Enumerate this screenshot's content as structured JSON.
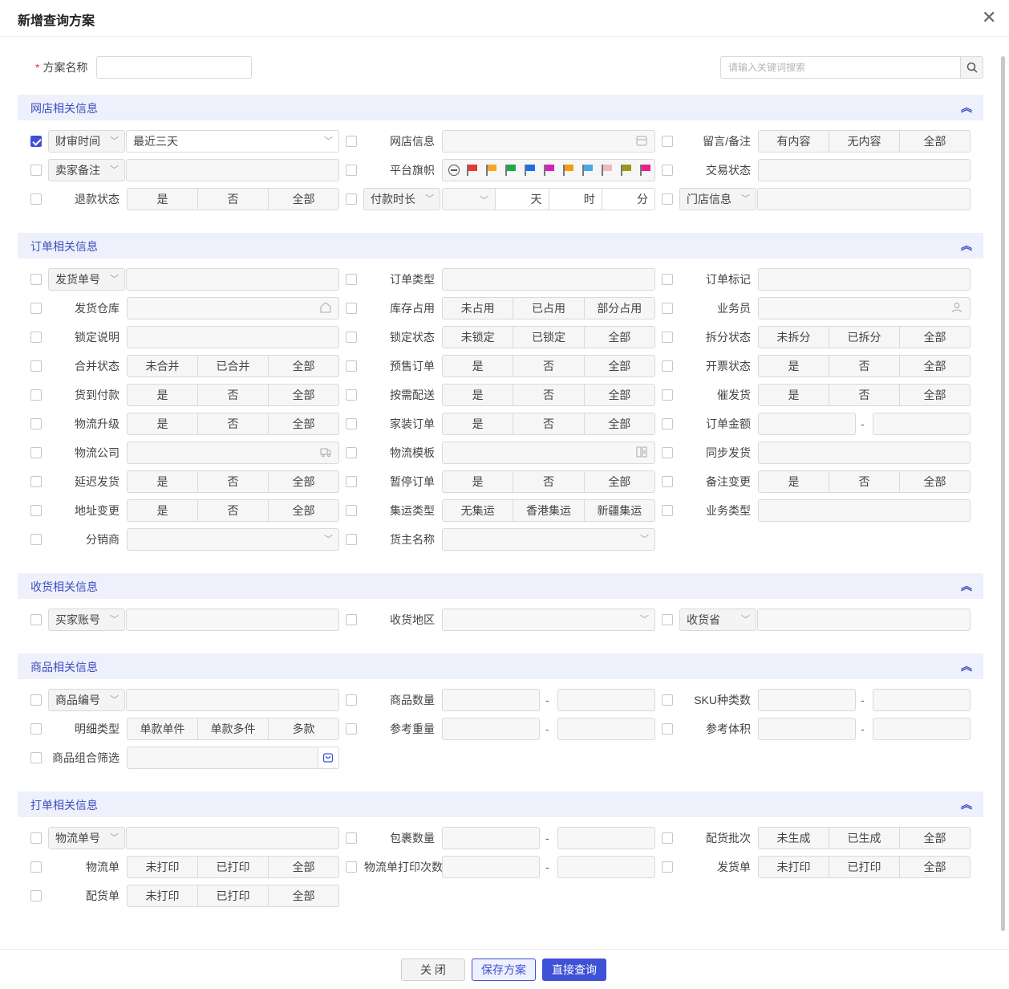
{
  "dialog": {
    "title": "新增查询方案"
  },
  "top": {
    "scheme_label": "方案名称",
    "required_mark": "*",
    "search_placeholder": "请输入关键词搜索"
  },
  "sections": {
    "shop": "网店相关信息",
    "order": "订单相关信息",
    "receive": "收货相关信息",
    "goods": "商品相关信息",
    "print": "打单相关信息"
  },
  "shop": {
    "audit_time": "财审时间",
    "audit_range": "最近三天",
    "shop_info": "网店信息",
    "message": "留言/备注",
    "message_opts": [
      "有内容",
      "无内容",
      "全部"
    ],
    "seller_memo": "卖家备注",
    "flag_label": "平台旗帜",
    "trade_status": "交易状态",
    "refund_status": "退款状态",
    "refund_opts": [
      "是",
      "否",
      "全部"
    ],
    "pay_duration": "付款时长",
    "pay_units": [
      "天",
      "时",
      "分"
    ],
    "store_info": "门店信息"
  },
  "order": {
    "ship_no": "发货单号",
    "order_type": "订单类型",
    "order_mark": "订单标记",
    "warehouse": "发货仓库",
    "stock": "库存占用",
    "stock_opts": [
      "未占用",
      "已占用",
      "部分占用"
    ],
    "salesman": "业务员",
    "lock_desc": "锁定说明",
    "lock_status": "锁定状态",
    "lock_opts": [
      "未锁定",
      "已锁定",
      "全部"
    ],
    "split_status": "拆分状态",
    "split_opts": [
      "未拆分",
      "已拆分",
      "全部"
    ],
    "merge_status": "合并状态",
    "merge_opts": [
      "未合并",
      "已合并",
      "全部"
    ],
    "presale": "预售订单",
    "invoice": "开票状态",
    "cod": "货到付款",
    "on_demand": "按需配送",
    "urge": "催发货",
    "logistics_up": "物流升级",
    "home_order": "家装订单",
    "amount": "订单金额",
    "logistics_co": "物流公司",
    "logistics_tpl": "物流模板",
    "sync_ship": "同步发货",
    "delay_ship": "延迟发货",
    "pause_order": "暂停订单",
    "memo_change": "备注变更",
    "addr_change": "地址变更",
    "consol": "集运类型",
    "consol_opts": [
      "无集运",
      "香港集运",
      "新疆集运"
    ],
    "biz_type": "业务类型",
    "distributor": "分销商",
    "owner": "货主名称",
    "yes_no_all": [
      "是",
      "否",
      "全部"
    ],
    "range_dash": "-"
  },
  "receive": {
    "buyer_account": "买家账号",
    "region": "收货地区",
    "province": "收货省"
  },
  "goods": {
    "goods_no": "商品编号",
    "goods_qty": "商品数量",
    "sku_kinds": "SKU种类数",
    "detail_type": "明细类型",
    "detail_opts": [
      "单款单件",
      "单款多件",
      "多款"
    ],
    "ref_weight": "参考重量",
    "ref_volume": "参考体积",
    "combo_filter": "商品组合筛选"
  },
  "print": {
    "tracking_no": "物流单号",
    "package_qty": "包裹数量",
    "pick_batch": "配货批次",
    "batch_opts": [
      "未生成",
      "已生成",
      "全部"
    ],
    "logistics_sheet": "物流单",
    "print_opts": [
      "未打印",
      "已打印",
      "全部"
    ],
    "print_times": "物流单打印次数",
    "ship_sheet": "发货单",
    "pick_sheet": "配货单"
  },
  "footer": {
    "close": "关 闭",
    "save": "保存方案",
    "query": "直接查询"
  },
  "colors": {
    "accent": "#3f51d6",
    "section_bg": "#eef0fb"
  },
  "flags": [
    "#e53935",
    "#f5a623",
    "#22a84a",
    "#1e6ee8",
    "#d61fbf",
    "#f39c12",
    "#4aa8e8",
    "#f2b8c0",
    "#9a9a1a",
    "#e91e8c"
  ]
}
